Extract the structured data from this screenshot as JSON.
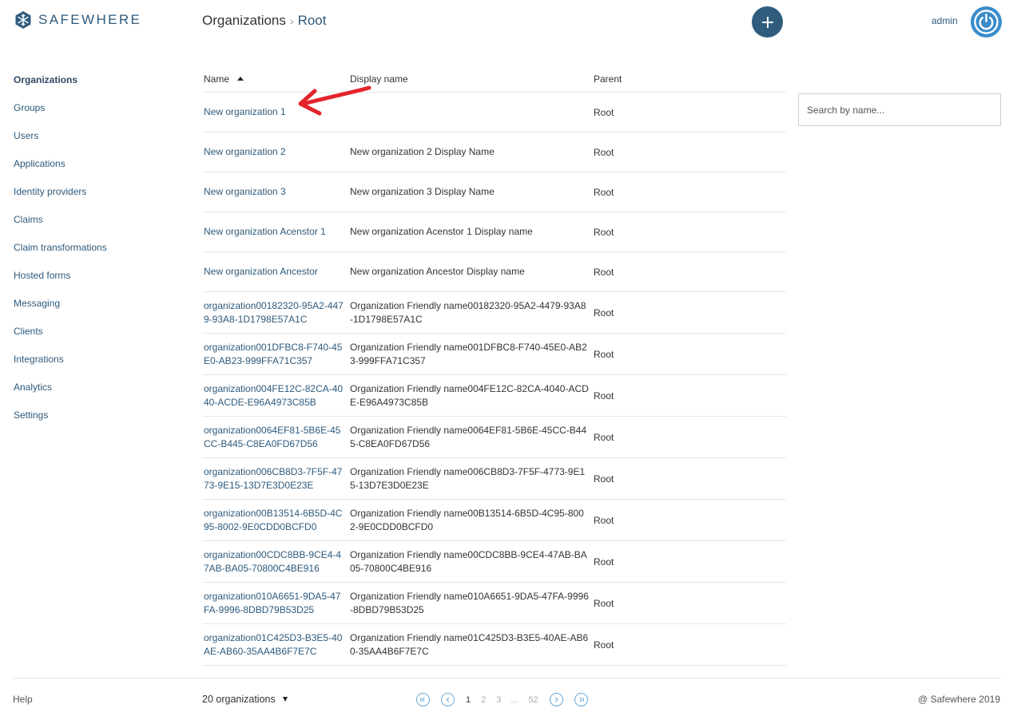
{
  "brand": {
    "name": "SAFEWHERE"
  },
  "breadcrumb": {
    "root_label": "Organizations",
    "separator": "›",
    "current_label": "Root"
  },
  "header": {
    "user_name": "admin"
  },
  "sidebar": {
    "items": [
      {
        "label": "Organizations",
        "active": true
      },
      {
        "label": "Groups"
      },
      {
        "label": "Users"
      },
      {
        "label": "Applications"
      },
      {
        "label": "Identity providers"
      },
      {
        "label": "Claims"
      },
      {
        "label": "Claim transformations"
      },
      {
        "label": "Hosted forms"
      },
      {
        "label": "Messaging"
      },
      {
        "label": "Clients"
      },
      {
        "label": "Integrations"
      },
      {
        "label": "Analytics"
      },
      {
        "label": "Settings"
      }
    ]
  },
  "table": {
    "columns": {
      "name": "Name",
      "display_name": "Display name",
      "parent": "Parent"
    },
    "sort": {
      "column": "Name",
      "direction": "ascending"
    },
    "rows": [
      {
        "name": "New organization 1",
        "display_name": "",
        "parent": "Root"
      },
      {
        "name": "New organization 2",
        "display_name": "New organization 2 Display Name",
        "parent": "Root"
      },
      {
        "name": "New organization 3",
        "display_name": "New organization 3 Display Name",
        "parent": "Root"
      },
      {
        "name": "New organization Acenstor 1",
        "display_name": "New organization Acenstor 1 Display name",
        "parent": "Root"
      },
      {
        "name": "New organization Ancestor",
        "display_name": "New organization Ancestor Display name",
        "parent": "Root"
      },
      {
        "name": "organization00182320-95A2-4479-93A8-1D1798E57A1C",
        "display_name": "Organization Friendly name00182320-95A2-4479-93A8-1D1798E57A1C",
        "parent": "Root"
      },
      {
        "name": "organization001DFBC8-F740-45E0-AB23-999FFA71C357",
        "display_name": "Organization Friendly name001DFBC8-F740-45E0-AB23-999FFA71C357",
        "parent": "Root"
      },
      {
        "name": "organization004FE12C-82CA-4040-ACDE-E96A4973C85B",
        "display_name": "Organization Friendly name004FE12C-82CA-4040-ACDE-E96A4973C85B",
        "parent": "Root"
      },
      {
        "name": "organization0064EF81-5B6E-45CC-B445-C8EA0FD67D56",
        "display_name": "Organization Friendly name0064EF81-5B6E-45CC-B445-C8EA0FD67D56",
        "parent": "Root"
      },
      {
        "name": "organization006CB8D3-7F5F-4773-9E15-13D7E3D0E23E",
        "display_name": "Organization Friendly name006CB8D3-7F5F-4773-9E15-13D7E3D0E23E",
        "parent": "Root"
      },
      {
        "name": "organization00B13514-6B5D-4C95-8002-9E0CDD0BCFD0",
        "display_name": "Organization Friendly name00B13514-6B5D-4C95-8002-9E0CDD0BCFD0",
        "parent": "Root"
      },
      {
        "name": "organization00CDC8BB-9CE4-47AB-BA05-70800C4BE916",
        "display_name": "Organization Friendly name00CDC8BB-9CE4-47AB-BA05-70800C4BE916",
        "parent": "Root"
      },
      {
        "name": "organization010A6651-9DA5-47FA-9996-8DBD79B53D25",
        "display_name": "Organization Friendly name010A6651-9DA5-47FA-9996-8DBD79B53D25",
        "parent": "Root"
      },
      {
        "name": "organization01C425D3-B3E5-40AE-AB60-35AA4B6F7E7C",
        "display_name": "Organization Friendly name01C425D3-B3E5-40AE-AB60-35AA4B6F7E7C",
        "parent": "Root"
      }
    ]
  },
  "search": {
    "placeholder": "Search by name...",
    "value": ""
  },
  "footer": {
    "help_label": "Help",
    "page_size_label": "20 organizations",
    "copyright": "@ Safewhere 2019"
  },
  "pagination": {
    "current_page": "1",
    "pages": [
      "1",
      "2",
      "3",
      "...",
      "52"
    ]
  },
  "colors": {
    "brand_blue": "#2e5a7c",
    "add_button": "#2f5c7d",
    "power_button": "#3a8ccb",
    "annotation_arrow": "#e3242b"
  },
  "icons": {
    "logo": "snowflake-logo-icon",
    "add": "plus-icon",
    "power": "power-icon",
    "sort": "sort-ascending-icon",
    "first_page": "first-page-icon",
    "prev_page": "prev-page-icon",
    "next_page": "next-page-icon",
    "last_page": "last-page-icon"
  }
}
